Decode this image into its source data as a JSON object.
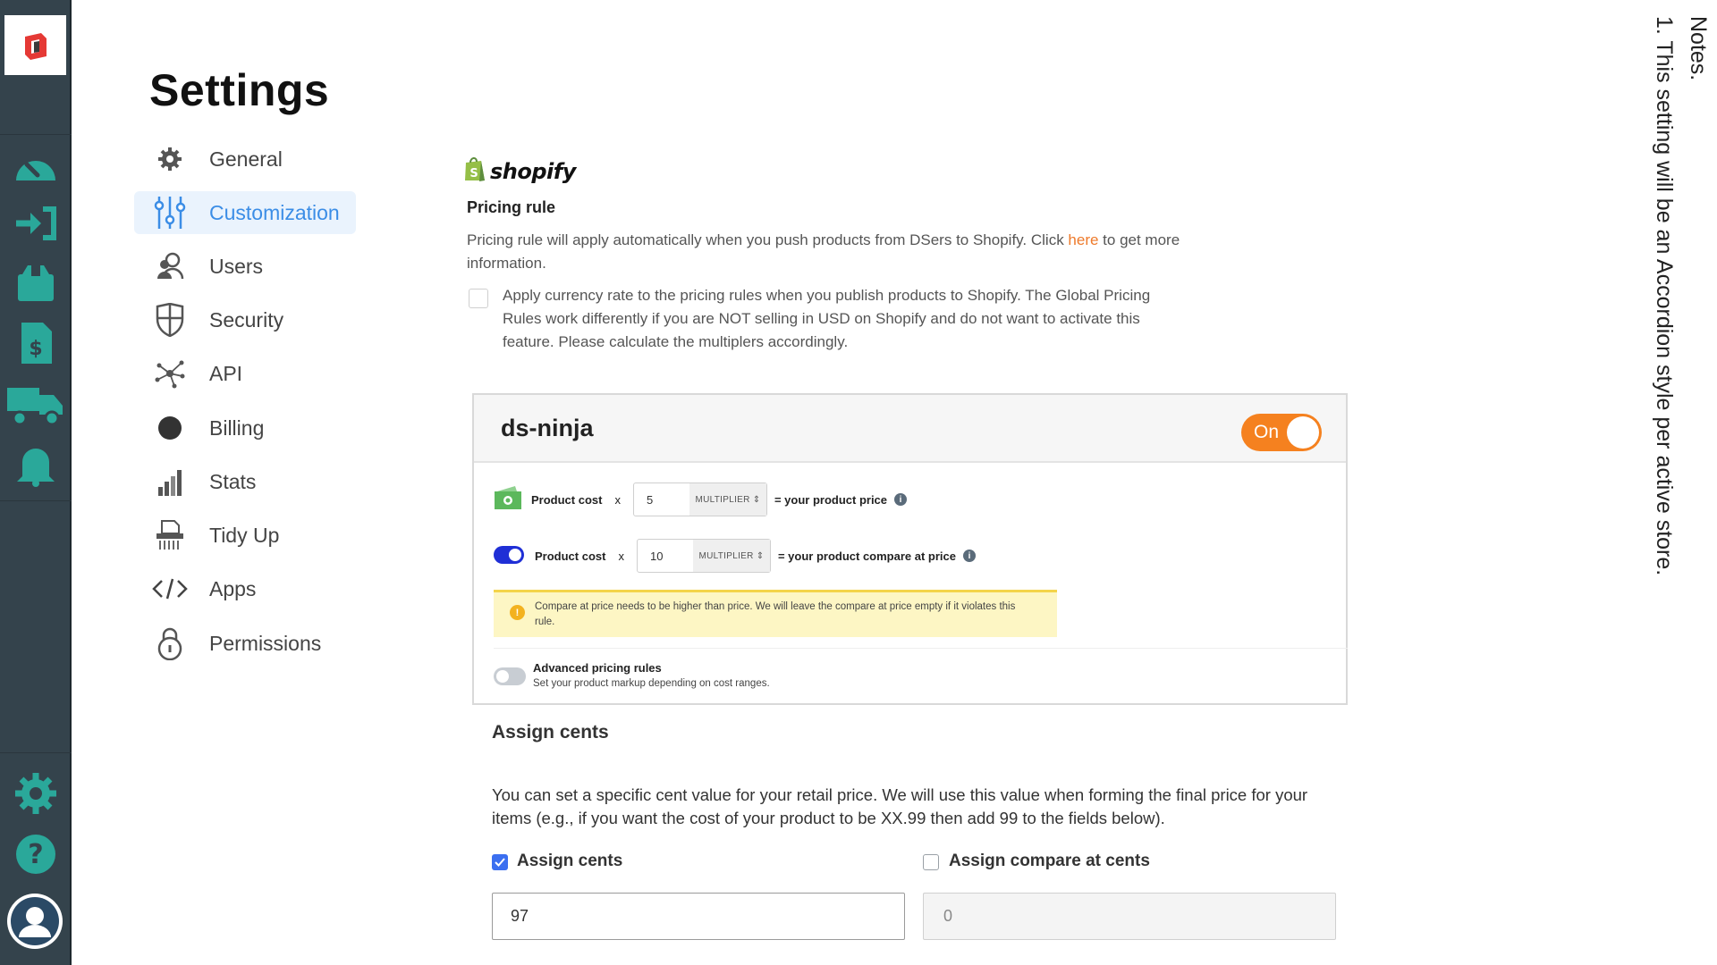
{
  "app": {
    "brand_color": "#e53935",
    "rail_color": "#34434c",
    "accent_color": "#3b8de6",
    "rail_icons": [
      "logo-icon",
      "dashboard-icon",
      "import-icon",
      "products-icon",
      "orders-icon",
      "shipping-icon",
      "notifications-icon",
      "settings-icon",
      "help-icon",
      "user-avatar-icon"
    ]
  },
  "page": {
    "title": "Settings"
  },
  "nav": {
    "items": [
      {
        "label": "General",
        "icon": "gear-icon"
      },
      {
        "label": "Customization",
        "icon": "sliders-icon",
        "active": true
      },
      {
        "label": "Users",
        "icon": "users-icon"
      },
      {
        "label": "Security",
        "icon": "shield-icon"
      },
      {
        "label": "API",
        "icon": "network-icon"
      },
      {
        "label": "Billing",
        "icon": "circle-icon"
      },
      {
        "label": "Stats",
        "icon": "chart-icon"
      },
      {
        "label": "Tidy Up",
        "icon": "shredder-icon"
      },
      {
        "label": "Apps",
        "icon": "code-icon"
      },
      {
        "label": "Permissions",
        "icon": "lock-icon"
      }
    ]
  },
  "pricing": {
    "platform": "shopify",
    "title": "Pricing rule",
    "desc_before": "Pricing rule will apply automatically when you push products from DSers to Shopify. Click ",
    "desc_link": "here",
    "desc_after": " to get more information.",
    "currency_checked": false,
    "currency_text": "Apply currency rate to the pricing rules when you publish products to Shopify. The Global Pricing Rules work differently if you are NOT selling in USD on Shopify and do not want to activate this feature. Please calculate the multiplers accordingly."
  },
  "store": {
    "name": "ds-ninja",
    "toggle_label": "On",
    "toggle_on": true,
    "rules": [
      {
        "label": "Product cost",
        "op": "x",
        "value": "5",
        "unit": "MULTIPLIER",
        "result": "= your product price"
      },
      {
        "label": "Product cost",
        "op": "x",
        "value": "10",
        "unit": "MULTIPLIER",
        "result": "= your product compare at price"
      }
    ],
    "warning": "Compare at price needs to be higher than price. We will leave the compare at price empty if it violates this rule.",
    "advanced": {
      "title": "Advanced pricing rules",
      "subtitle": "Set your product markup depending on cost ranges.",
      "enabled": false
    }
  },
  "assign": {
    "title": "Assign cents",
    "desc": "You can set a specific cent value for your retail price. We will use this value when forming the final price for your items (e.g., if you want the cost of your product to be XX.99 then add 99 to the fields below).",
    "cents_label": "Assign cents",
    "cents_checked": true,
    "cents_value": "97",
    "compare_label": "Assign compare at cents",
    "compare_checked": false,
    "compare_value": "0"
  },
  "notes": {
    "heading": "Notes.",
    "line1": "1. This setting will be an Accordion style per active store."
  }
}
